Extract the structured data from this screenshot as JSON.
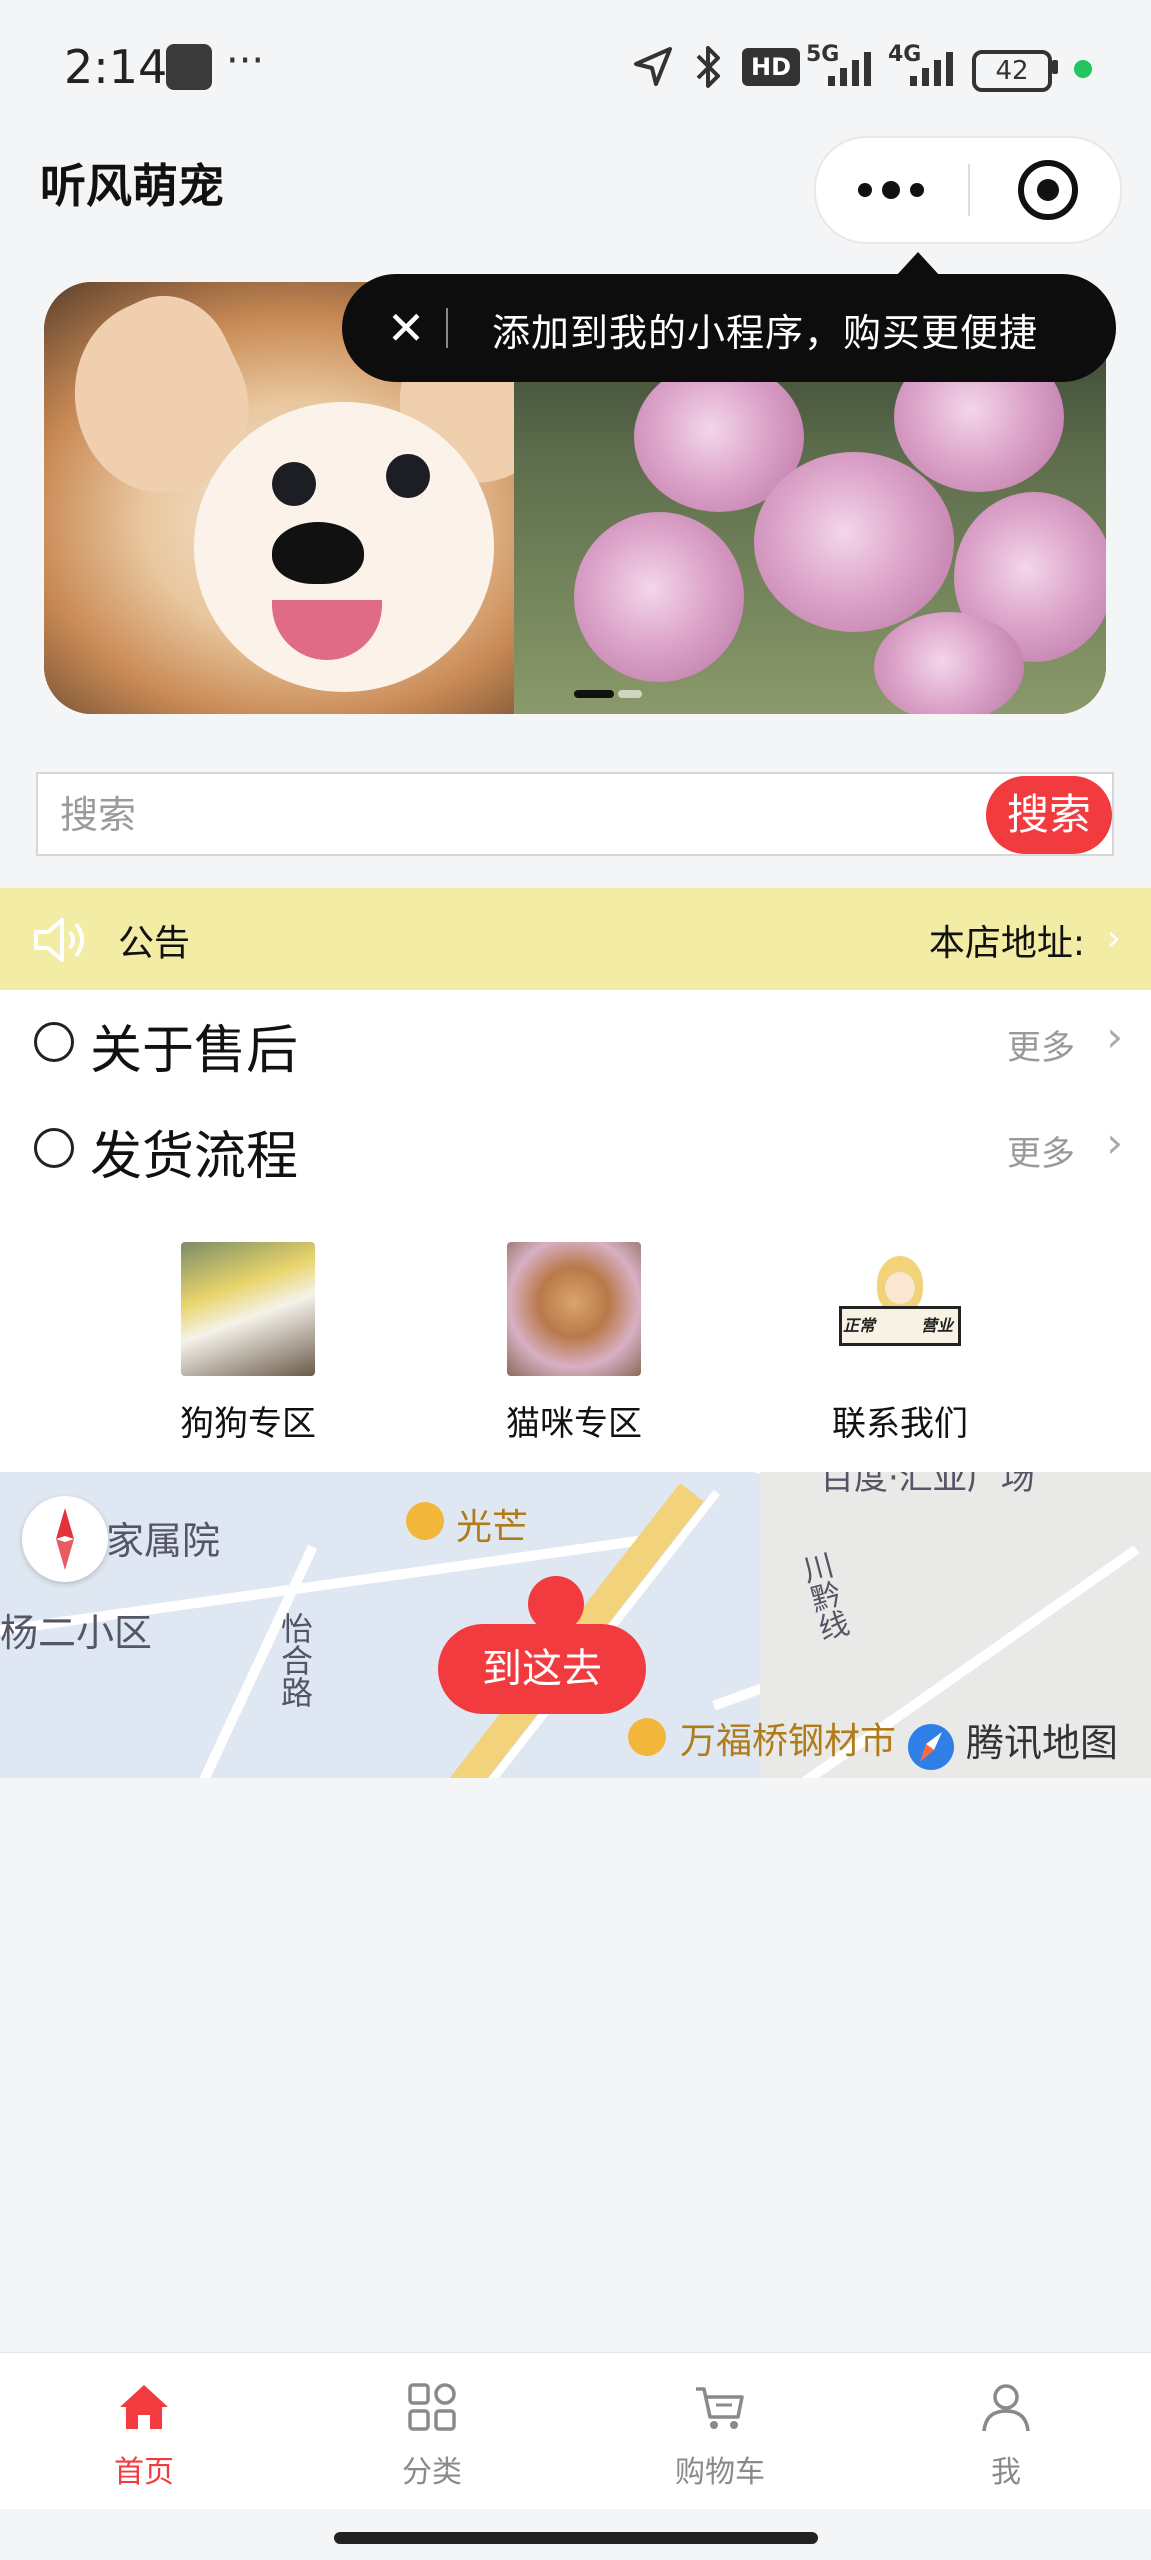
{
  "status_bar": {
    "time": "2:14",
    "more": "···",
    "network_labels": [
      "HD",
      "5G",
      "4G"
    ],
    "battery": "42"
  },
  "header": {
    "title": "听风萌宠"
  },
  "tooltip": {
    "close": "✕",
    "text": "添加到我的小程序，购买更便捷"
  },
  "search": {
    "placeholder": "搜索",
    "button": "搜索"
  },
  "notice": {
    "label": "公告",
    "address": "本店地址:"
  },
  "list": [
    {
      "title": "关于售后",
      "more": "更多"
    },
    {
      "title": "发货流程",
      "more": "更多"
    }
  ],
  "categories": [
    {
      "label": "狗狗专区"
    },
    {
      "label": "猫咪专区"
    },
    {
      "label": "联系我们",
      "stamp_text": [
        "正常",
        "营业"
      ]
    }
  ],
  "map": {
    "labels": [
      "家属院",
      "杨二小区",
      "怡合路",
      "川黔线",
      "百度·汇亚广场"
    ],
    "pois": [
      "光芒",
      "万福桥钢材市"
    ],
    "go_button": "到这去",
    "provider": "腾讯地图"
  },
  "tabbar": [
    {
      "label": "首页",
      "active": true
    },
    {
      "label": "分类",
      "active": false
    },
    {
      "label": "购物车",
      "active": false
    },
    {
      "label": "我",
      "active": false
    }
  ],
  "colors": {
    "accent": "#f23b3f",
    "notice_bg": "#f3eca4",
    "inactive_tab": "#8a8a8a"
  }
}
